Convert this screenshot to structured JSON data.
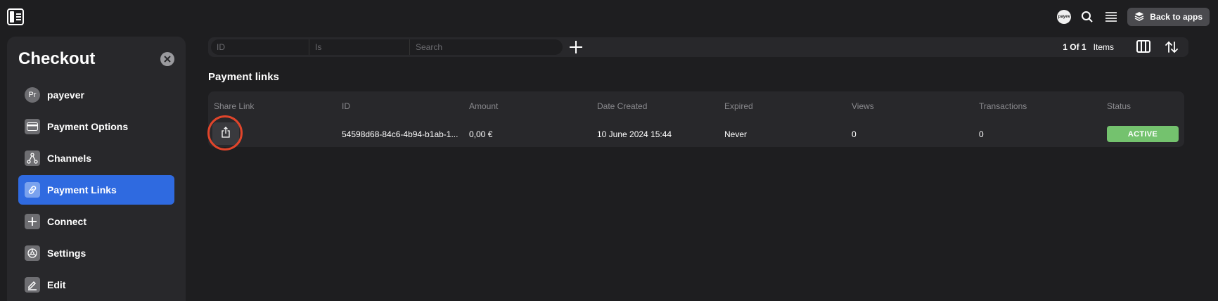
{
  "topbar": {
    "avatar_text": "payev",
    "back_label": "Back to apps",
    "icons": [
      "sidebar-toggle-icon",
      "search-icon",
      "menu-icon",
      "layers-icon"
    ]
  },
  "sidebar": {
    "title": "Checkout",
    "items": [
      {
        "label": "payever",
        "icon": "avatar",
        "avatar_text": "Pr",
        "active": false
      },
      {
        "label": "Payment Options",
        "icon": "card-icon",
        "active": false
      },
      {
        "label": "Channels",
        "icon": "channels-icon",
        "active": false
      },
      {
        "label": "Payment Links",
        "icon": "link-icon",
        "active": true
      },
      {
        "label": "Connect",
        "icon": "plus-icon",
        "active": false
      },
      {
        "label": "Settings",
        "icon": "settings-icon",
        "active": false
      },
      {
        "label": "Edit",
        "icon": "edit-icon",
        "active": false
      }
    ]
  },
  "filter": {
    "field_placeholder": "ID",
    "condition_placeholder": "Is",
    "search_placeholder": "Search",
    "page_info": "1 Of 1",
    "items_label": "Items"
  },
  "section_title": "Payment links",
  "table": {
    "headers": [
      "Share Link",
      "ID",
      "Amount",
      "Date Created",
      "Expired",
      "Views",
      "Transactions",
      "Status"
    ],
    "rows": [
      {
        "id": "54598d68-84c6-4b94-b1ab-1...",
        "amount": "0,00 €",
        "date_created": "10 June 2024 15:44",
        "expired": "Never",
        "views": "0",
        "transactions": "0",
        "status": "ACTIVE"
      }
    ]
  },
  "colors": {
    "accent": "#2f6ae0",
    "status_active": "#74c26e",
    "highlight": "#e0452b"
  }
}
